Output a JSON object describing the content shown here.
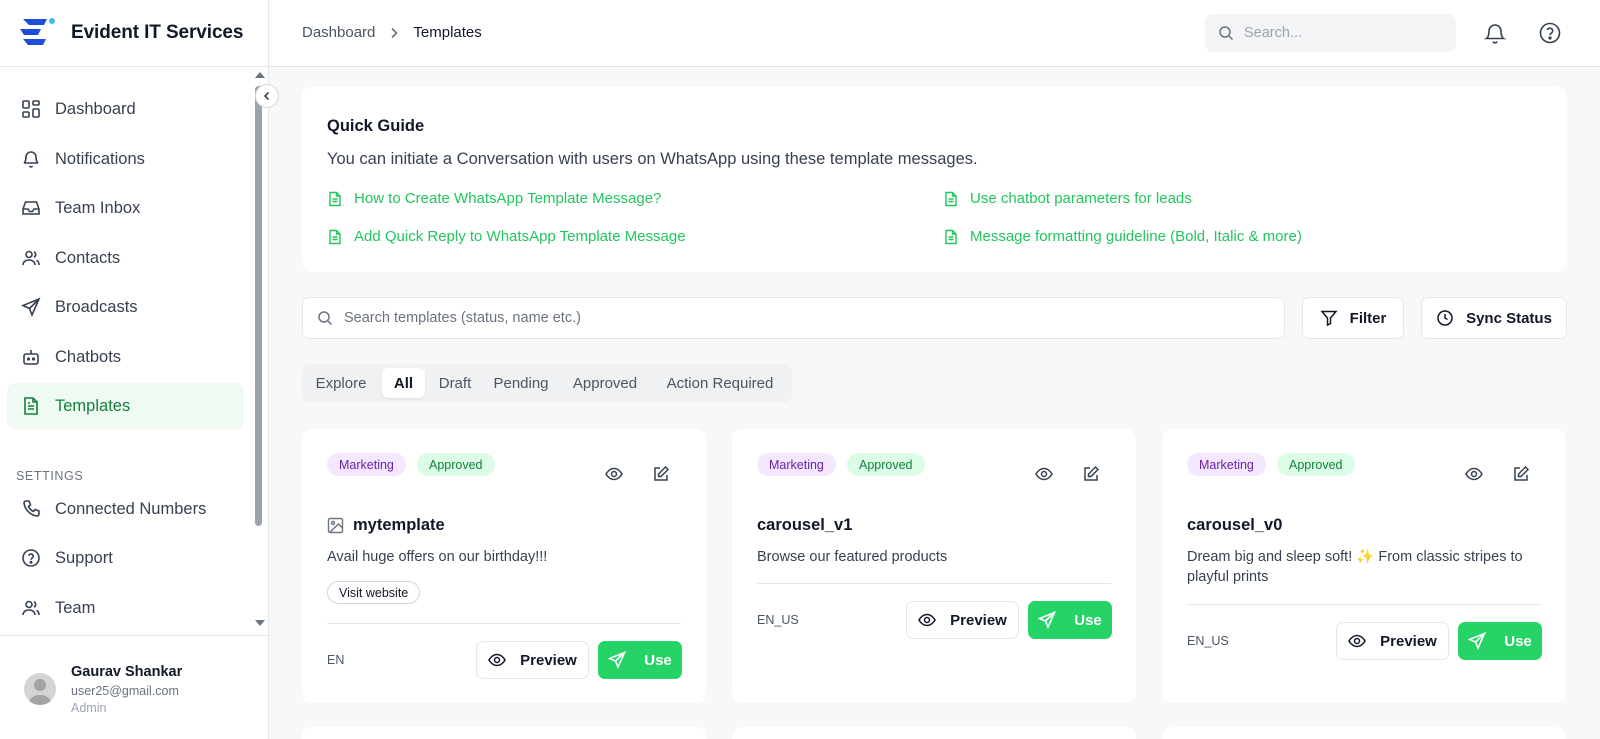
{
  "brand": {
    "name": "Evident IT Services",
    "accent": "#1d4ed8"
  },
  "breadcrumb": {
    "parent": "Dashboard",
    "current": "Templates"
  },
  "header": {
    "search_placeholder": "Search..."
  },
  "sidebar": {
    "items": [
      {
        "label": "Dashboard",
        "icon": "grid-icon"
      },
      {
        "label": "Notifications",
        "icon": "bell-icon"
      },
      {
        "label": "Team Inbox",
        "icon": "inbox-icon"
      },
      {
        "label": "Contacts",
        "icon": "users-icon"
      },
      {
        "label": "Broadcasts",
        "icon": "send-icon"
      },
      {
        "label": "Chatbots",
        "icon": "bot-icon"
      },
      {
        "label": "Templates",
        "icon": "file-text-icon",
        "active": true
      }
    ],
    "settings_label": "SETTINGS",
    "settings_items": [
      {
        "label": "Connected Numbers",
        "icon": "phone-icon"
      },
      {
        "label": "Support",
        "icon": "help-icon"
      },
      {
        "label": "Team",
        "icon": "users-icon"
      }
    ]
  },
  "user": {
    "name": "Gaurav Shankar",
    "email": "user25@gmail.com",
    "role": "Admin"
  },
  "guide": {
    "title": "Quick Guide",
    "description": "You can initiate a Conversation with users on WhatsApp using these template messages.",
    "links": [
      "How to Create WhatsApp Template Message?",
      "Use chatbot parameters for leads",
      "Add Quick Reply to WhatsApp Template Message",
      "Message formatting guideline (Bold, Italic & more)"
    ]
  },
  "toolbar": {
    "search_placeholder": "Search templates (status, name etc.)",
    "filter_label": "Filter",
    "sync_label": "Sync Status"
  },
  "tabs": [
    "Explore",
    "All",
    "Draft",
    "Pending",
    "Approved",
    "Action Required"
  ],
  "active_tab": "All",
  "cards": [
    {
      "category": "Marketing",
      "status": "Approved",
      "name": "mytemplate",
      "has_image_icon": true,
      "description": "Avail huge offers on our birthday!!!",
      "button_chip": "Visit website",
      "language": "EN",
      "preview_label": "Preview",
      "use_label": "Use"
    },
    {
      "category": "Marketing",
      "status": "Approved",
      "name": "carousel_v1",
      "description": "Browse our featured products",
      "language": "EN_US",
      "preview_label": "Preview",
      "use_label": "Use"
    },
    {
      "category": "Marketing",
      "status": "Approved",
      "name": "carousel_v0",
      "description": "Dream big and sleep soft! ✨ From classic stripes to playful prints",
      "language": "EN_US",
      "preview_label": "Preview",
      "use_label": "Use"
    }
  ],
  "colors": {
    "green": "#25d366",
    "link_green": "#22c55e",
    "active_bg": "#effaf2"
  }
}
